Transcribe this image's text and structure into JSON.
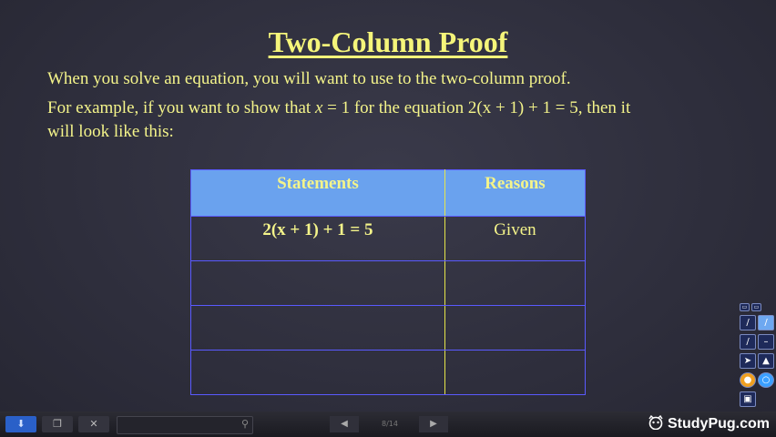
{
  "slide": {
    "title": "Two-Column Proof",
    "line1": "When you solve an equation, you will want to use to the two-column proof.",
    "line2_prefix": "For example, if you want to show that ",
    "line2_var": "x",
    "line2_eq": " = 1",
    "line2_mid": " for the equation ",
    "line2_equation": "2(x + 1) + 1 = 5",
    "line2_suffix": ", then it",
    "line3": "will look like this:"
  },
  "table": {
    "headers": [
      "Statements",
      "Reasons"
    ],
    "rows": [
      [
        "2(x + 1) + 1 = 5",
        "Given"
      ],
      [
        "",
        ""
      ],
      [
        "",
        ""
      ],
      [
        "",
        ""
      ]
    ]
  },
  "pager": {
    "label": "8/14"
  },
  "brand": {
    "name": "StudyPug.com"
  },
  "colors": {
    "accent_text": "#f4f48a",
    "header_fill": "#6aa2ee",
    "grid": "#5a5aff"
  }
}
